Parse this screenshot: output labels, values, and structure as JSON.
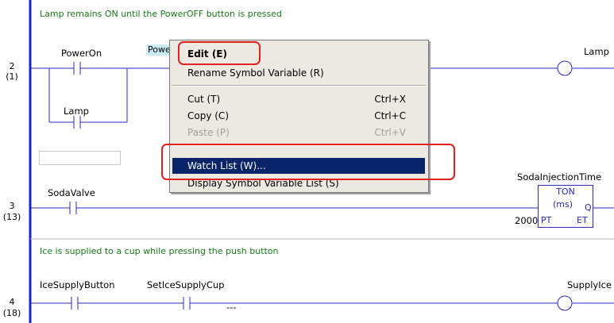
{
  "comments": {
    "rung2": "Lamp remains ON until the  PowerOFF button is pressed",
    "rung4": "Ice is supplied to a cup while pressing the push button"
  },
  "rungs": {
    "r2_num": "2",
    "r2_step": "(1)",
    "r3_num": "3",
    "r3_step": "(13)",
    "r4_num": "4",
    "r4_step": "(18)"
  },
  "contacts": {
    "power_on": "PowerOn",
    "lamp_branch": "Lamp",
    "soda_valve": "SodaValve",
    "ice_supply_button": "IceSupplyButton",
    "set_ice_supply_cup": "SetIceSupplyCup"
  },
  "coils": {
    "lamp": "Lamp",
    "supply_ice": "SupplyIce"
  },
  "selected_tag": "PowerOFF",
  "timer": {
    "name": "SodaInjectionTime",
    "type": "TON",
    "unit": "(ms)",
    "q": "Q",
    "pt": "PT",
    "et": "ET",
    "preset": "2000"
  },
  "dashes": "---",
  "context_menu": {
    "items": [
      {
        "label": "Edit (E)",
        "shortcut": ""
      },
      {
        "label": "Rename Symbol Variable (R)",
        "shortcut": ""
      },
      {
        "label": "Cut (T)",
        "shortcut": "Ctrl+X"
      },
      {
        "label": "Copy (C)",
        "shortcut": "Ctrl+C"
      },
      {
        "label": "Paste (P)",
        "shortcut": "Ctrl+V"
      },
      {
        "label": "Watch List (W)...",
        "shortcut": ""
      },
      {
        "label": "Display Symbol Variable List (S)",
        "shortcut": ""
      }
    ]
  },
  "colors": {
    "rail": "#1f1fd0",
    "comment": "#1a7a1a",
    "menu_selection": "#0a246a",
    "highlight": "#e0211f"
  }
}
